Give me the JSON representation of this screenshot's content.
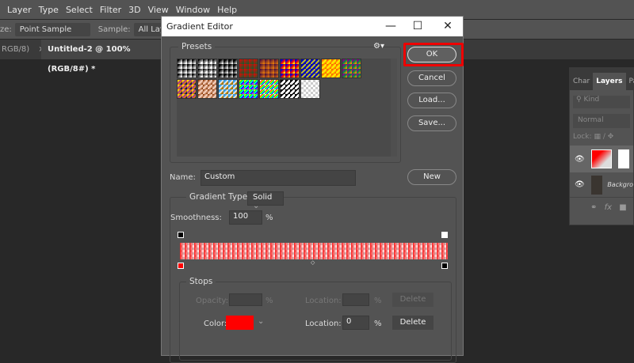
{
  "menu": [
    "Layer",
    "Type",
    "Select",
    "Filter",
    "3D",
    "View",
    "Window",
    "Help"
  ],
  "options": {
    "size_label": "ze:",
    "size_value": "Point Sample",
    "sample_label": "Sample:",
    "sample_value": "All Layers"
  },
  "tabs": [
    {
      "label": "RGB/8)",
      "close": "×"
    },
    {
      "label": "Untitled-2 @ 100% (RGB/8#) *",
      "close": "×"
    }
  ],
  "layers_panel": {
    "tabs": [
      "Char",
      "Layers",
      "Pa"
    ],
    "kind": "Kind",
    "blend": "Normal",
    "lock_label": "Lock:",
    "background_layer": "Backgro",
    "fx": "fx"
  },
  "dialog": {
    "title": "Gradient Editor",
    "presets_label": "Presets",
    "presets": [
      "black-white",
      "black-transparent",
      "black-white-2",
      "red-green",
      "violet-orange",
      "blue-red-yellow",
      "blue-yellow-blue",
      "orange-yellow-orange",
      "violet-green-orange",
      "yellow-violet-orange-blue",
      "copper",
      "chrome",
      "spectrum",
      "transparent-rainbow",
      "transparent-stripes",
      "transparent"
    ],
    "buttons": {
      "ok": "OK",
      "cancel": "Cancel",
      "load": "Load...",
      "save": "Save...",
      "new": "New"
    },
    "name_label": "Name:",
    "name_value": "Custom",
    "gradient_type_label": "Gradient Type:",
    "gradient_type_value": "Solid",
    "smoothness_label": "Smoothness:",
    "smoothness_value": "100",
    "percent": "%",
    "start_color": "#ff1a1a",
    "stops": {
      "label": "Stops",
      "opacity_label": "Opacity:",
      "location_label": "Location:",
      "delete": "Delete",
      "color_label": "Color:",
      "color_value": "#ff0000",
      "location_value": "0"
    }
  }
}
